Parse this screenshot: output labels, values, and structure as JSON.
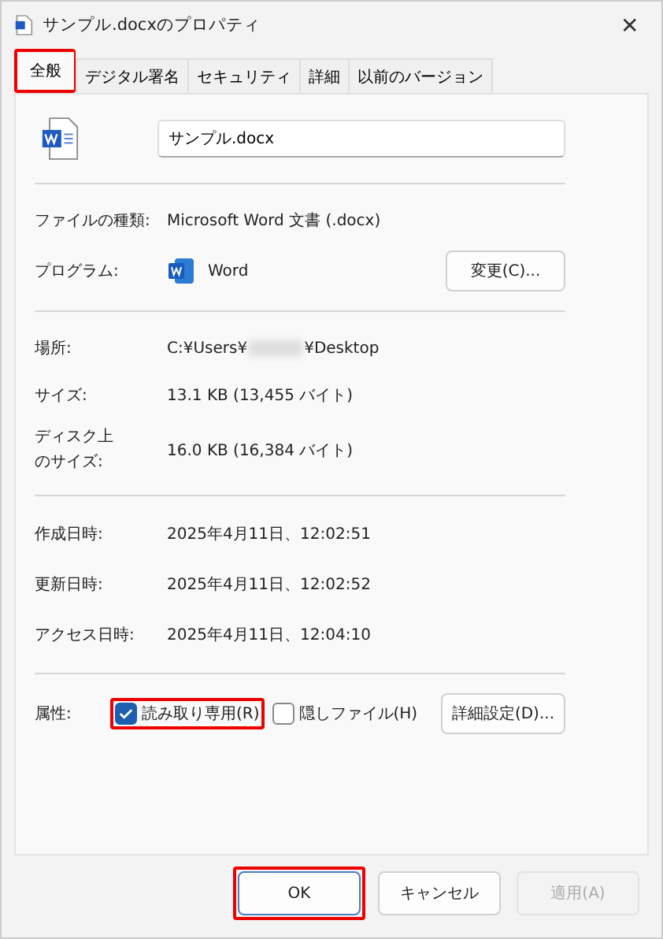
{
  "window": {
    "title": "サンプル.docxのプロパティ",
    "close": "✕"
  },
  "tabs": [
    {
      "label": "全般",
      "selected": true,
      "highlighted": true
    },
    {
      "label": "デジタル署名",
      "selected": false,
      "highlighted": false
    },
    {
      "label": "セキュリティ",
      "selected": false,
      "highlighted": false
    },
    {
      "label": "詳細",
      "selected": false,
      "highlighted": false
    },
    {
      "label": "以前のバージョン",
      "selected": false,
      "highlighted": false
    }
  ],
  "file_name": {
    "value": "サンプル.docx"
  },
  "type": {
    "label": "ファイルの種類:",
    "value": "Microsoft Word 文書 (.docx)"
  },
  "program": {
    "label": "プログラム:",
    "value": "Word",
    "button": "変更(C)..."
  },
  "location": {
    "label": "場所:",
    "value_start": "C:¥Users¥",
    "value_end": "¥Desktop",
    "redacted": true
  },
  "size": {
    "label": "サイズ:",
    "value": "13.1 KB (13,455 バイト)"
  },
  "disk_size": {
    "label": "ディスク上のサイズ:",
    "value": "16.0 KB (16,384 バイト)"
  },
  "dates": [
    {
      "label": "作成日時:",
      "value": "2025年4月11日、12:02:51"
    },
    {
      "label": "更新日時:",
      "value": "2025年4月11日、12:02:52"
    },
    {
      "label": "アクセス日時:",
      "value": "2025年4月11日、12:04:10"
    }
  ],
  "attributes": {
    "label": "属性:",
    "checkboxes": [
      {
        "label": "読み取り専用(R)",
        "checked": true,
        "highlighted": true
      },
      {
        "label": "隠しファイル(H)",
        "checked": false,
        "highlighted": false
      }
    ],
    "button": "詳細設定(D)..."
  },
  "buttons": [
    {
      "label": "OK",
      "disabled": false,
      "highlighted": true
    },
    {
      "label": "キャンセル",
      "disabled": false,
      "highlighted": false
    },
    {
      "label": "適用(A)",
      "disabled": true,
      "highlighted": false
    }
  ]
}
